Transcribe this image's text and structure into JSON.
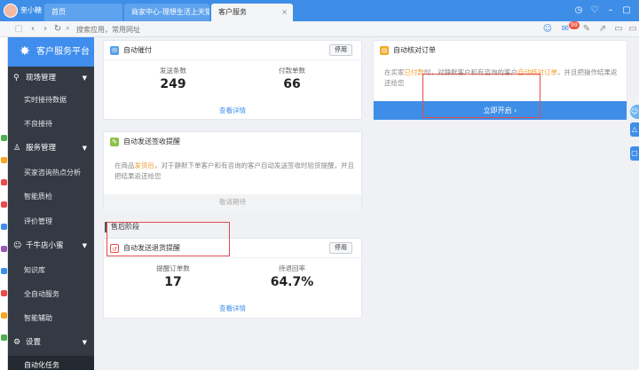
{
  "browser": {
    "user_name": "奎小糖",
    "tabs": [
      {
        "label": "首页",
        "active": false
      },
      {
        "label": "商家中心-理想生活上天猫",
        "active": false
      },
      {
        "label": "客户服务",
        "active": true
      }
    ],
    "tab_close": "×",
    "address_placeholder": "搜索应用，常用网址",
    "mail_badge": "99"
  },
  "sidebar": {
    "title": "客户服务平台",
    "groups": [
      {
        "label": "现场管理",
        "items": [
          "实时接待数据",
          "不良接待"
        ]
      },
      {
        "label": "服务管理",
        "items": [
          "买家咨询热点分析",
          "智能质检",
          "评价管理"
        ]
      },
      {
        "label": "千牛店小蜜",
        "items": [
          "知识库",
          "全自动服务",
          "智能辅助"
        ]
      },
      {
        "label": "设置",
        "items": [
          "自动化任务"
        ]
      }
    ]
  },
  "cards": {
    "auto_remind": {
      "title": "自动催付",
      "button": "停用",
      "stats": [
        {
          "label": "发送条数",
          "value": "249"
        },
        {
          "label": "付款单数",
          "value": "66"
        }
      ],
      "link": "查看详情"
    },
    "auto_check_order": {
      "title": "自动核对订单",
      "desc_pre": "在买家",
      "desc_hl1": "已付款",
      "desc_mid": "时，对静默客户和有咨询的客户",
      "desc_hl2": "自动核对订单",
      "desc_post": "，并且把操作结果返还给您",
      "button": "立即开启",
      "button_arrow": "›"
    },
    "auto_sign_remind": {
      "title": "自动发送签收提醒",
      "desc_pre": "在商品",
      "desc_hl": "发货后",
      "desc_post": "，对于静默下单客户和有咨询的客户自动发送签收时验货提醒，并且把结果返还给您",
      "footer": "敬请期待"
    },
    "section_after_sale": "售后阶段",
    "auto_return_remind": {
      "title": "自动发送退货提醒",
      "button": "停用",
      "stats": [
        {
          "label": "提醒订单数",
          "value": "17"
        },
        {
          "label": "待退回率",
          "value": "64.7%"
        }
      ],
      "link": "查看详情"
    }
  },
  "colors": {
    "tabbar": "#3e8ee8",
    "sidebar": "#333a44",
    "sidebar_header": "#3f8ded",
    "highlight": "#f39b2e",
    "highlight_box": "#e24b4b"
  }
}
